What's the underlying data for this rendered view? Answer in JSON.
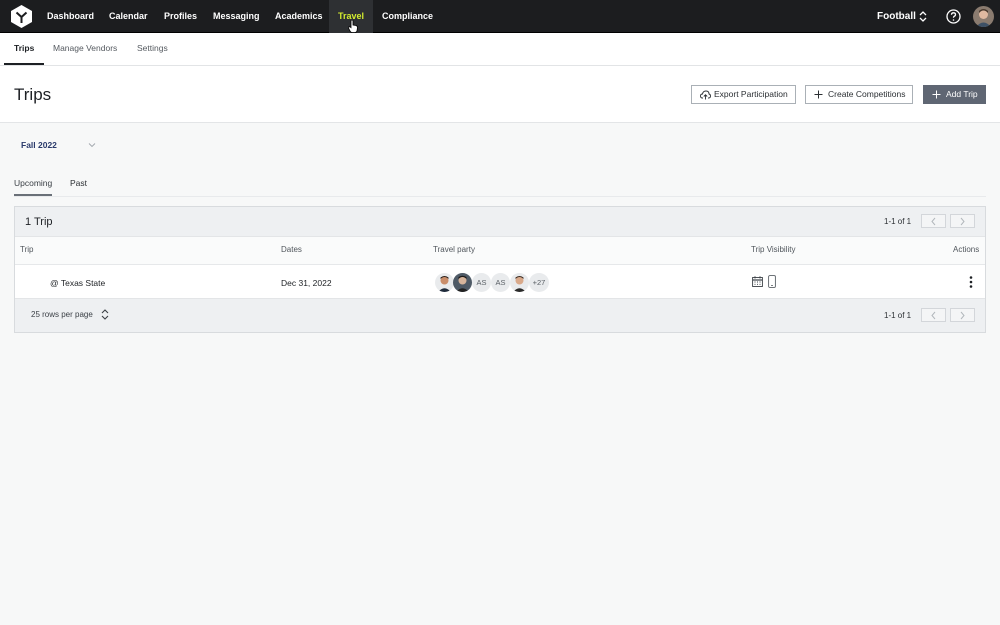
{
  "nav": {
    "items": [
      {
        "label": "Dashboard"
      },
      {
        "label": "Calendar"
      },
      {
        "label": "Profiles"
      },
      {
        "label": "Messaging"
      },
      {
        "label": "Academics"
      },
      {
        "label": "Travel"
      },
      {
        "label": "Compliance"
      }
    ],
    "team": "Football"
  },
  "subnav": {
    "tabs": [
      {
        "label": "Trips"
      },
      {
        "label": "Manage Vendors"
      },
      {
        "label": "Settings"
      }
    ]
  },
  "page": {
    "title": "Trips",
    "export_label": "Export Participation",
    "create_label": "Create Competitions",
    "add_label": "Add Trip"
  },
  "season": {
    "selected": "Fall 2022"
  },
  "tabs": [
    {
      "label": "Upcoming"
    },
    {
      "label": "Past"
    }
  ],
  "table": {
    "title": "1 Trip",
    "pager": "1-1 of 1",
    "columns": [
      "Trip",
      "Dates",
      "Travel party",
      "Trip Visibility",
      "Actions"
    ],
    "rows": [
      {
        "trip": "@ Texas State",
        "date": "Dec 31, 2022",
        "party_initials": [
          "AS",
          "AS"
        ],
        "party_more": "+27"
      }
    ],
    "rows_per_page": "25 rows per page"
  },
  "colors": {
    "nav_bg": "#1c1d1f",
    "nav_active": "#d4ec2f",
    "primary_button": "#5f6673",
    "season_text": "#2a3a6b"
  }
}
